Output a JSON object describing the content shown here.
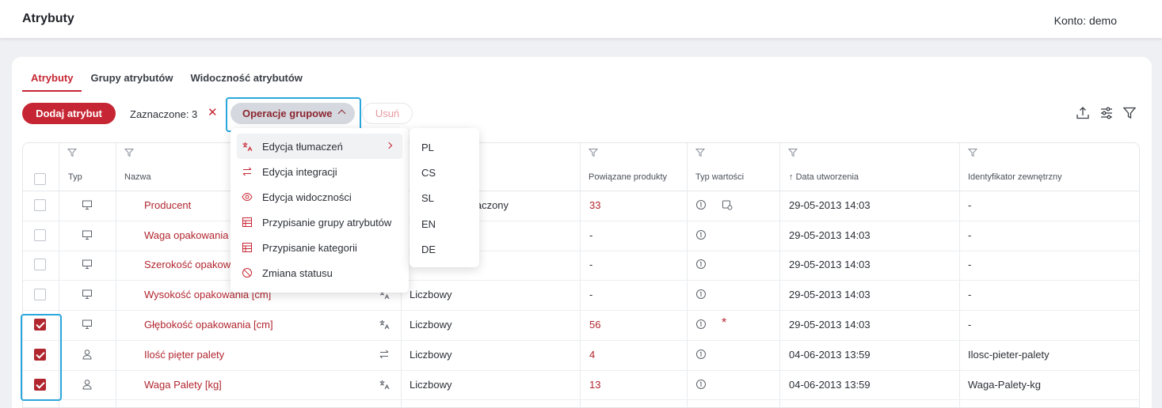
{
  "header": {
    "title": "Atrybuty",
    "account": "Konto: demo"
  },
  "tabs": [
    {
      "label": "Atrybuty",
      "active": true
    },
    {
      "label": "Grupy atrybutów",
      "active": false
    },
    {
      "label": "Widoczność atrybutów",
      "active": false
    }
  ],
  "toolbar": {
    "add_label": "Dodaj atrybut",
    "selected_label": "Zaznaczone: 3",
    "clear_icon": "close-icon",
    "group_ops_label": "Operacje grupowe",
    "delete_label": "Usuń",
    "right_icons": [
      "export-icon",
      "settings-sliders-icon",
      "filter-icon"
    ]
  },
  "table": {
    "headers": {
      "type": "Typ",
      "name": "Nazwa",
      "linked": "Powiązane produkty",
      "value_type": "Typ wartości",
      "created": "Data utworzenia",
      "external_id": "Identyfikator zewnętrzny"
    },
    "sort_indicator": "↑",
    "rows": [
      {
        "checked": false,
        "type_icon": "monitor-icon",
        "name": "Producent",
        "kind": "...aczony",
        "linked": "33",
        "created": "29-05-2013 14:03",
        "external_id": "-"
      },
      {
        "checked": false,
        "type_icon": "monitor-icon",
        "name": "Waga opakowania",
        "kind": "",
        "linked": "-",
        "created": "29-05-2013 14:03",
        "external_id": "-"
      },
      {
        "checked": false,
        "type_icon": "monitor-icon",
        "name": "Szerokość opakow...",
        "kind": "",
        "linked": "-",
        "created": "29-05-2013 14:03",
        "external_id": "-"
      },
      {
        "checked": false,
        "type_icon": "monitor-icon",
        "name": "Wysokość opakowania [cm]",
        "kind": "Liczbowy",
        "linked": "-",
        "created": "29-05-2013 14:03",
        "external_id": "-"
      },
      {
        "checked": true,
        "type_icon": "monitor-icon",
        "name": "Głębokość opakowania [cm]",
        "kind": "Liczbowy",
        "linked": "56",
        "created": "29-05-2013 14:03",
        "external_id": "-"
      },
      {
        "checked": true,
        "type_icon": "user-icon",
        "name": "Ilość pięter palety",
        "kind": "Liczbowy",
        "linked": "4",
        "created": "04-06-2013 13:59",
        "external_id": "Ilosc-pieter-palety"
      },
      {
        "checked": true,
        "type_icon": "user-icon",
        "name": "Waga Palety [kg]",
        "kind": "Liczbowy",
        "linked": "13",
        "created": "04-06-2013 13:59",
        "external_id": "Waga-Palety-kg"
      }
    ]
  },
  "menu": {
    "items": [
      {
        "label": "Edycja tłumaczeń",
        "icon": "translate-icon",
        "has_submenu": true,
        "active": true
      },
      {
        "label": "Edycja integracji",
        "icon": "arrows-exchange-icon",
        "has_submenu": false,
        "active": false
      },
      {
        "label": "Edycja widoczności",
        "icon": "eye-icon",
        "has_submenu": false,
        "active": false
      },
      {
        "label": "Przypisanie grupy atrybutów",
        "icon": "table-icon",
        "has_submenu": false,
        "active": false
      },
      {
        "label": "Przypisanie kategorii",
        "icon": "table-icon",
        "has_submenu": false,
        "active": false
      },
      {
        "label": "Zmiana statusu",
        "icon": "ban-icon",
        "has_submenu": false,
        "active": false
      }
    ],
    "submenu": [
      "PL",
      "CS",
      "SL",
      "EN",
      "DE"
    ]
  },
  "colors": {
    "brand": "#c62633",
    "highlight": "#2aa7dc"
  }
}
